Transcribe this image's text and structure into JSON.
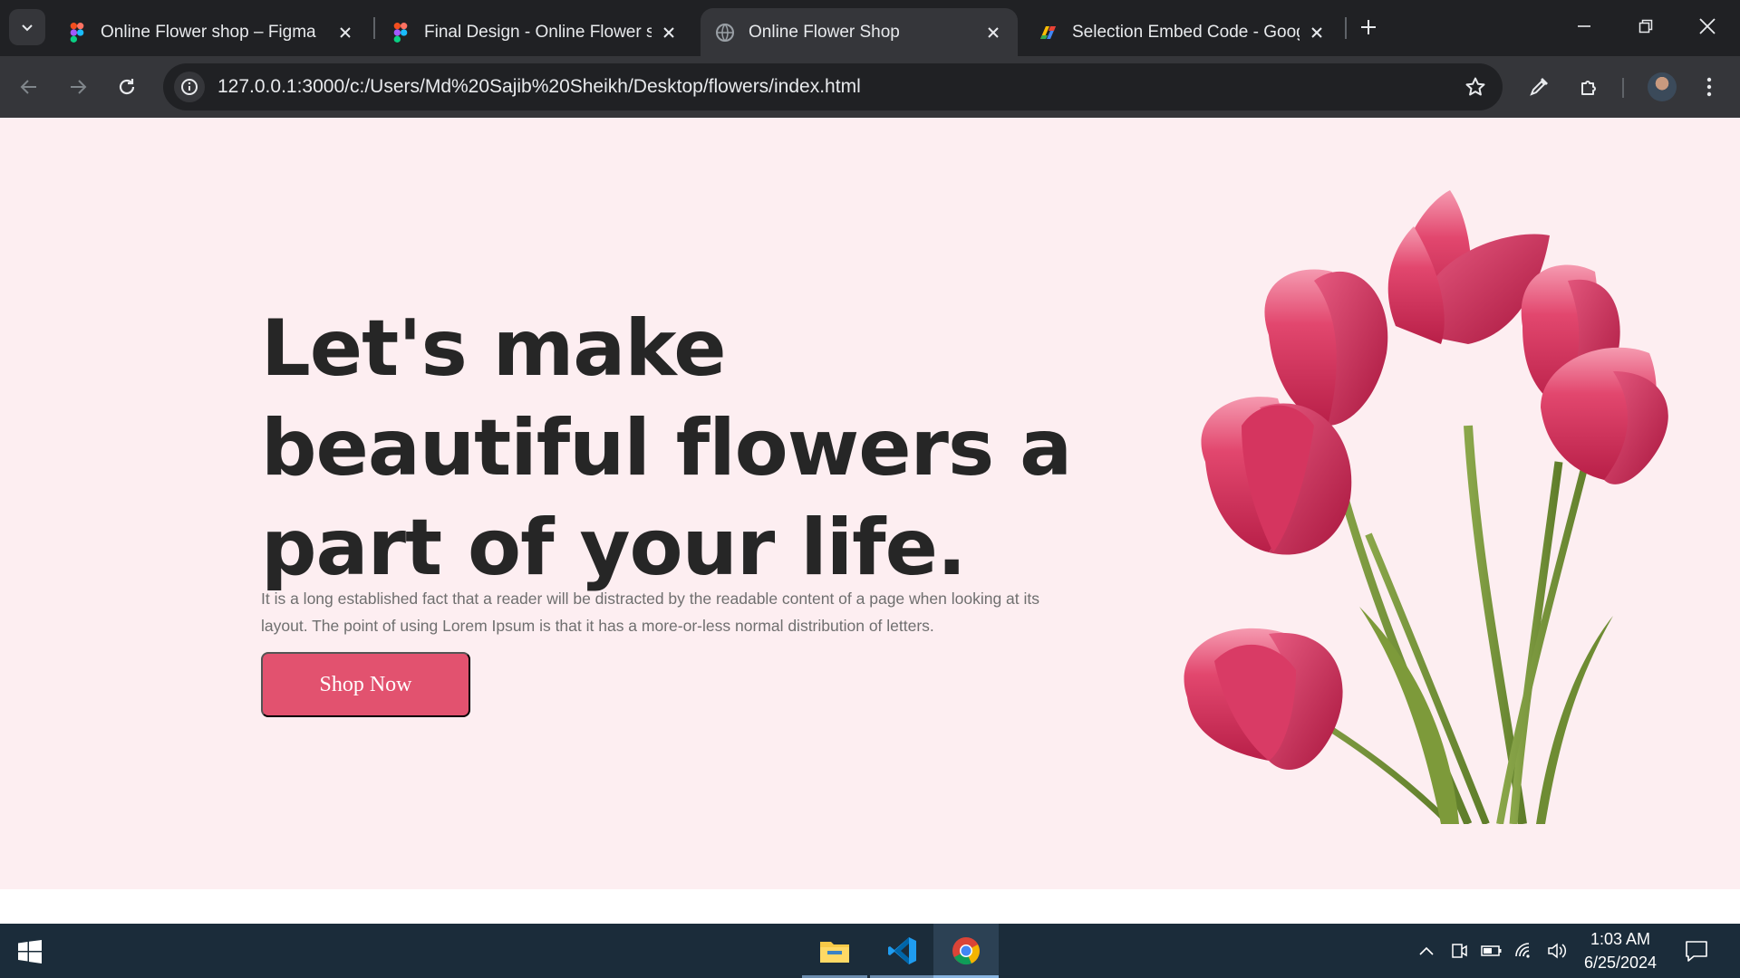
{
  "browser": {
    "tabs": [
      {
        "title": "Online Flower shop – Figma",
        "icon": "figma-icon",
        "active": false
      },
      {
        "title": "Final Design - Online Flower shop",
        "icon": "figma-icon",
        "active": false
      },
      {
        "title": "Online Flower Shop",
        "icon": "globe-icon",
        "active": true
      },
      {
        "title": "Selection Embed Code - Google",
        "icon": "google-apps-icon",
        "active": false
      }
    ],
    "url_host": "127.0.0.1",
    "url_rest": ":3000/c:/Users/Md%20Sajib%20Sheikh/Desktop/flowers/index.html"
  },
  "page": {
    "hero": {
      "title_lines": [
        "Let's make",
        "beautiful flowers a",
        "part of your life."
      ],
      "description": "It is a long established fact that a reader will be distracted by the readable content of a page when looking at its layout. The point of using Lorem Ipsum is that it has a more-or-less normal distribution of letters.",
      "button_label": "Shop Now"
    }
  },
  "taskbar": {
    "apps": [
      "file-explorer",
      "vs-code",
      "chrome"
    ],
    "time": "1:03 AM",
    "date": "6/25/2024"
  },
  "colors": {
    "hero_bg": "#fdeef1",
    "heading": "#262626",
    "body_text": "#6f6f6f",
    "button_bg": "#e2526f",
    "tulip": "#d63a63",
    "chrome_bg": "#202124",
    "taskbar_bg": "#1b2c3a"
  }
}
